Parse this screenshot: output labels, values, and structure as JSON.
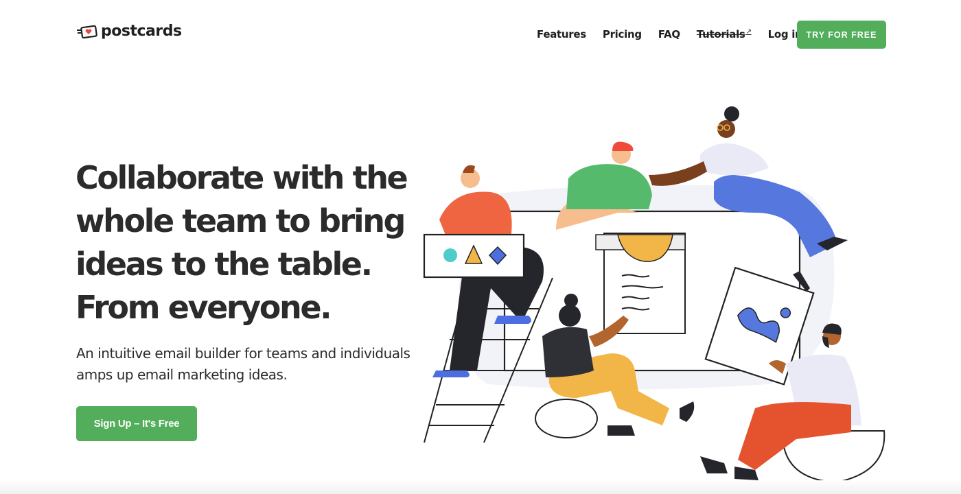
{
  "brand": {
    "name": "postcards",
    "accent": "#52ae5a"
  },
  "nav": {
    "items": [
      {
        "label": "Features"
      },
      {
        "label": "Pricing"
      },
      {
        "label": "FAQ"
      },
      {
        "label": "Tutorials",
        "external_mark": "↗"
      },
      {
        "label": "Log in"
      }
    ],
    "cta": "TRY FOR FREE"
  },
  "hero": {
    "title_lines": [
      "Collaborate with the",
      "whole team to bring",
      "ideas to the table.",
      "From everyone."
    ],
    "subtitle_lines": [
      "An intuitive email builder for teams and individuals",
      "amps up email marketing ideas."
    ],
    "cta": "Sign Up – It's Free"
  },
  "illustration": {
    "description": "Team of five people collaborating around a large board",
    "colors": {
      "orange_shirt": "#ef6542",
      "green_shirt": "#55ba6b",
      "blue_pants": "#5677dd",
      "yellow": "#f2b548",
      "dark": "#25262b",
      "skin_light": "#f6bd8f",
      "skin_dark": "#7a3f1c",
      "skin_mid": "#b3652e",
      "board_bg": "#f2f3f9",
      "white_shirt": "#e9eaf5",
      "red_pants": "#e5532e",
      "teal": "#4fcbcb"
    }
  }
}
